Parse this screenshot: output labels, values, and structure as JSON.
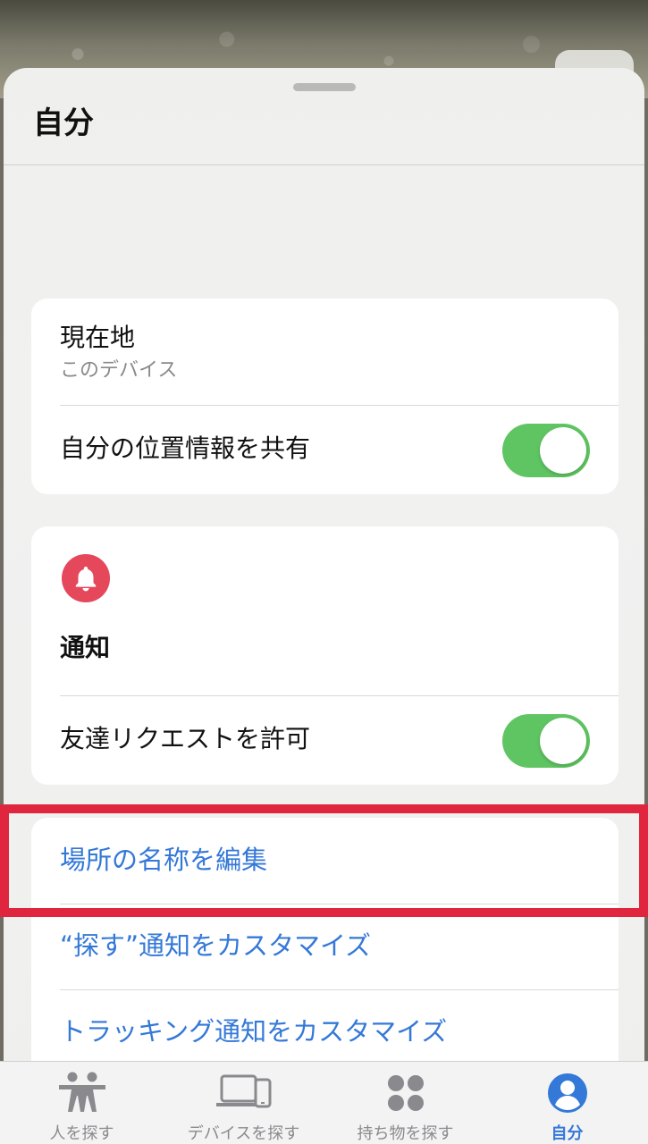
{
  "sheet": {
    "title": "自分"
  },
  "location_card": {
    "title": "現在地",
    "subtitle": "このデバイス",
    "share_label": "自分の位置情報を共有",
    "share_enabled": true
  },
  "notifications_card": {
    "icon": "bell-icon",
    "heading": "通知",
    "friend_requests_label": "友達リクエストを許可",
    "friend_requests_enabled": true
  },
  "links": {
    "edit_places": "場所の名称を編集",
    "customize_findmy": "“探す”通知をカスタマイズ",
    "customize_tracking": "トラッキング通知をカスタマイズ"
  },
  "tabbar": {
    "tabs": [
      {
        "label": "人を探す",
        "icon": "people-icon"
      },
      {
        "label": "デバイスを探す",
        "icon": "devices-icon"
      },
      {
        "label": "持ち物を探す",
        "icon": "items-icon"
      },
      {
        "label": "自分",
        "icon": "person-circle-icon",
        "active": true
      }
    ]
  },
  "colors": {
    "accent": "#3478d8",
    "toggle_on": "#5fc562",
    "bell_badge": "#e5475b",
    "highlight": "#e0263f"
  }
}
